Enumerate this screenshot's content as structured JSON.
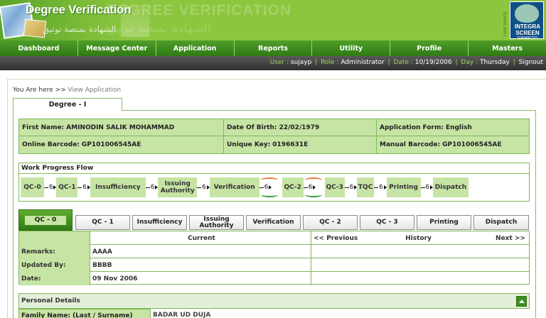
{
  "header": {
    "title": "Degree Verification",
    "watermark": "DEGREE VERIFICATION",
    "arabic": "الشهادة بمنصة توثيق",
    "arabic_ghost": "الشهادة بمنصة توثيق",
    "logo_line1": "INTEGRA",
    "logo_line2": "SCREEN",
    "logo_line3": "ENHANCED",
    "logo_side": "CLIENT SERVICES"
  },
  "nav": [
    "Dashboard",
    "Message Center",
    "Application",
    "Reports",
    "Utility",
    "Profile",
    "Masters"
  ],
  "status": {
    "user_label": "User :",
    "user": "sujayp",
    "role_label": "Role :",
    "role": "Administrator",
    "date_label": "Date :",
    "date": "10/19/2006",
    "day_label": "Day :",
    "day": "Thursday",
    "signout": "Signout"
  },
  "breadcrumb": {
    "prefix": "You Are here >>",
    "current": "View Application"
  },
  "degree_tab": "Degree - I",
  "info": {
    "first_name_label": "First Name:",
    "first_name": "AMINODIN SALIK MOHAMMAD",
    "dob_label": "Date Of Birth:",
    "dob": "22/02/1979",
    "form_label": "Application Form:",
    "form": "English",
    "online_barcode_label": "Online Barcode:",
    "online_barcode": "GP101006545AE",
    "unique_key_label": "Unique Key:",
    "unique_key": "0196631E",
    "manual_barcode_label": "Manual Barcode:",
    "manual_barcode": "GP101006545AE"
  },
  "work_flow": {
    "title": "Work Progress Flow",
    "nodes": [
      "QC-0",
      "QC-1",
      "Insufficiency",
      "Issuing Authority",
      "Verification",
      "QC-2",
      "QC-3",
      "TQC",
      "Printing",
      "Dispatch"
    ],
    "counts": [
      "6",
      "6",
      "6",
      "6",
      "6",
      "6",
      "6",
      "6",
      "6"
    ]
  },
  "stage_tabs": [
    "QC - 0",
    "QC - 1",
    "Insufficiency",
    "Issuing Authority",
    "Verification",
    "QC - 2",
    "QC - 3",
    "Printing",
    "Dispatch"
  ],
  "history": {
    "current_label": "Current",
    "prev_label": "<< Previous",
    "history_label": "History",
    "next_label": "Next >>",
    "rows": [
      {
        "label": "Remarks:",
        "value": "AAAA"
      },
      {
        "label": "Updated By:",
        "value": "BBBB"
      },
      {
        "label": "Date:",
        "value": "09 Nov 2006"
      }
    ]
  },
  "personal": {
    "title": "Personal Details",
    "family_label": "Family Name: (Last / Surname)",
    "family_value": "BADAR UD DUJA"
  },
  "colors": {
    "brand_green": "#8cc63e",
    "nav_green": "#2f7a14",
    "cell_green": "#c6e4a4",
    "status_dark": "#2e2e2e",
    "accent_label": "#9bd35a"
  }
}
